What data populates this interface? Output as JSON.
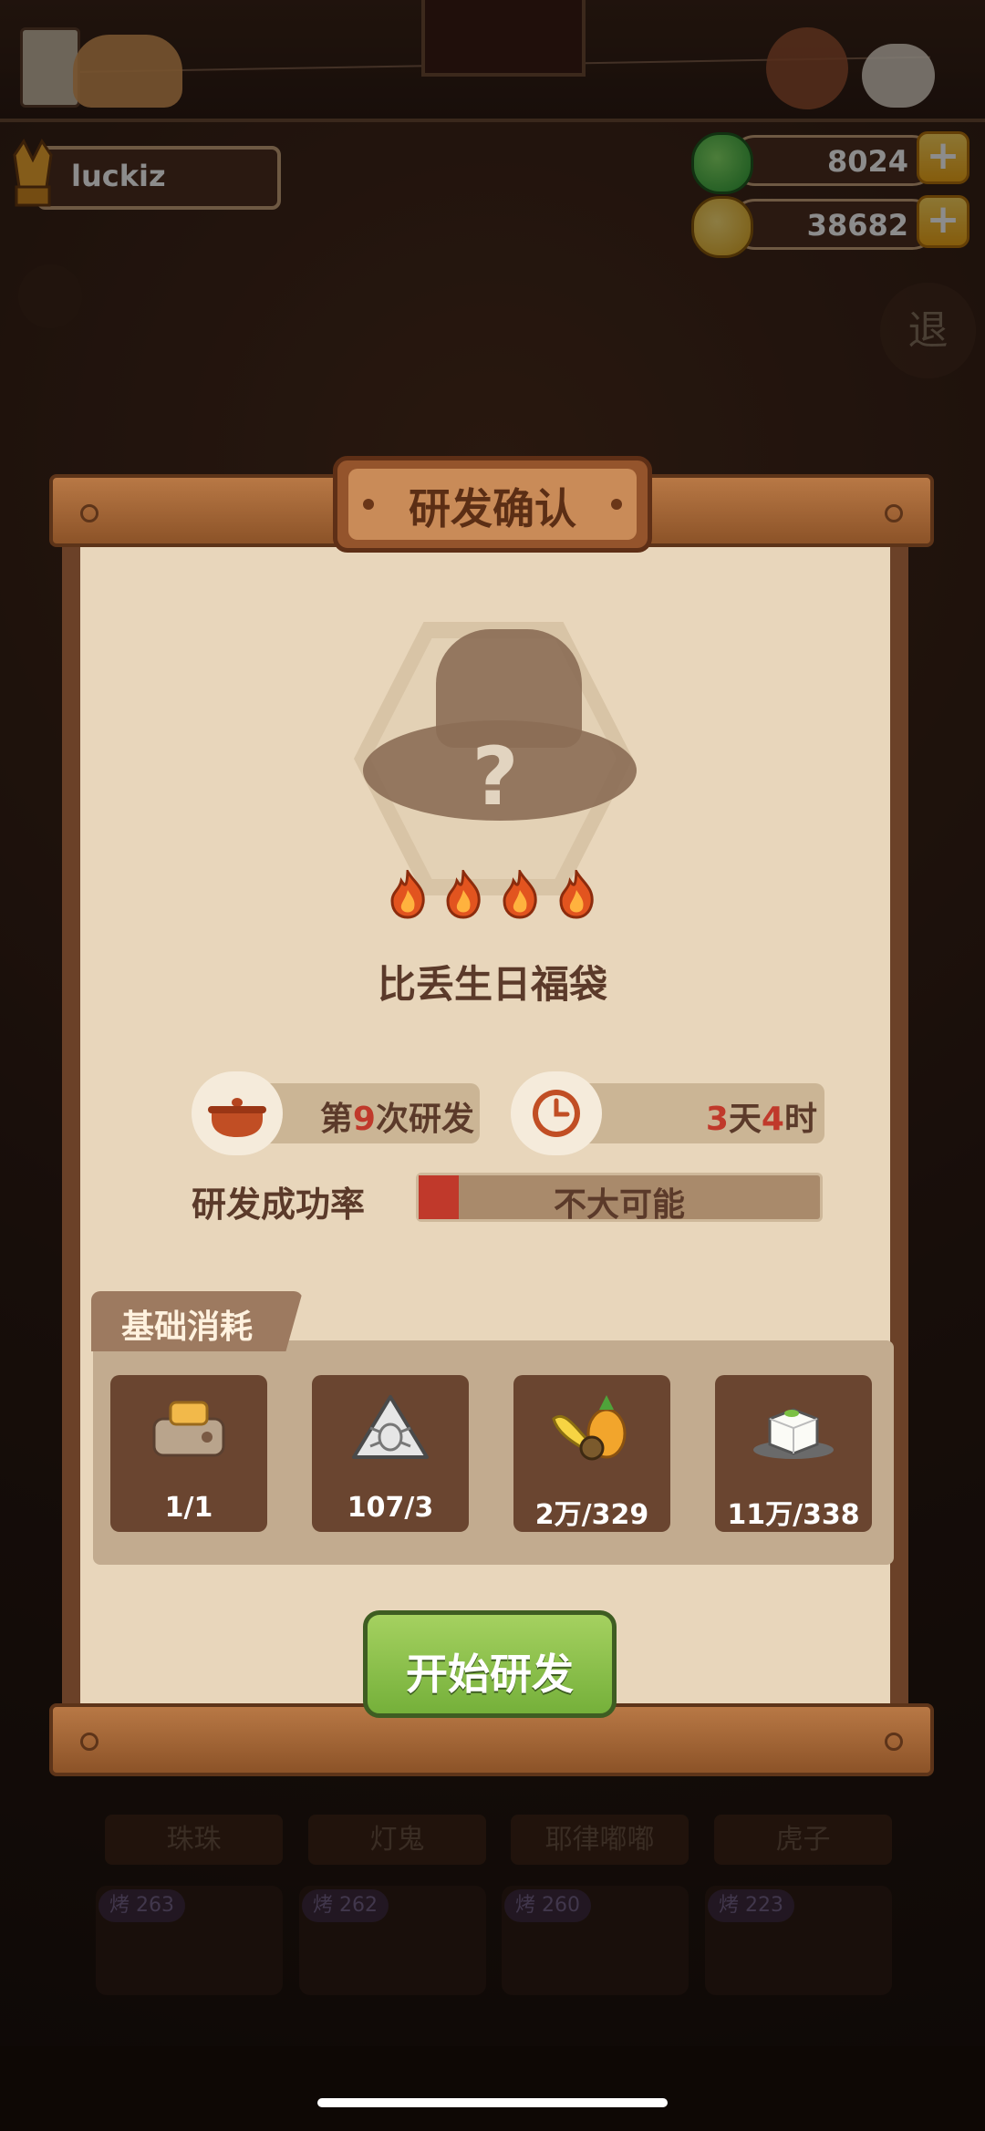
{
  "header": {
    "username": "luckiz",
    "jade_value": "8024",
    "coin_value": "38682",
    "exit_label": "退"
  },
  "dialog": {
    "title": "研发确认",
    "dish_name": "比丢生日福袋",
    "unknown_mark": "?",
    "flame_count": 4,
    "attempt_prefix": "第",
    "attempt_number": "9",
    "attempt_suffix": "次研发",
    "time_days": "3",
    "time_day_unit": "天",
    "time_hours": "4",
    "time_hour_unit": "时",
    "success_rate_label": "研发成功率",
    "success_rate_value": "不大可能",
    "success_rate_fill": 0.1,
    "cost_section_title": "基础消耗",
    "cost_items": [
      {
        "icon": "toaster-icon",
        "count": "1/1"
      },
      {
        "icon": "bug-token-icon",
        "count": "107/3"
      },
      {
        "icon": "fruit-icon",
        "count": "2万/329"
      },
      {
        "icon": "tofu-icon",
        "count": "11万/338"
      }
    ],
    "start_button": "开始研发"
  },
  "background_list": {
    "slots": [
      "珠珠",
      "灯鬼",
      "耶律嘟嘟",
      "虎子"
    ],
    "badges": [
      {
        "tag": "烤",
        "value": "263"
      },
      {
        "tag": "烤",
        "value": "262"
      },
      {
        "tag": "烤",
        "value": "260"
      },
      {
        "tag": "烤",
        "value": "223"
      }
    ]
  },
  "colors": {
    "accent_red": "#c0392b",
    "button_green": "#75b03a",
    "paper": "#e8d6bb"
  }
}
